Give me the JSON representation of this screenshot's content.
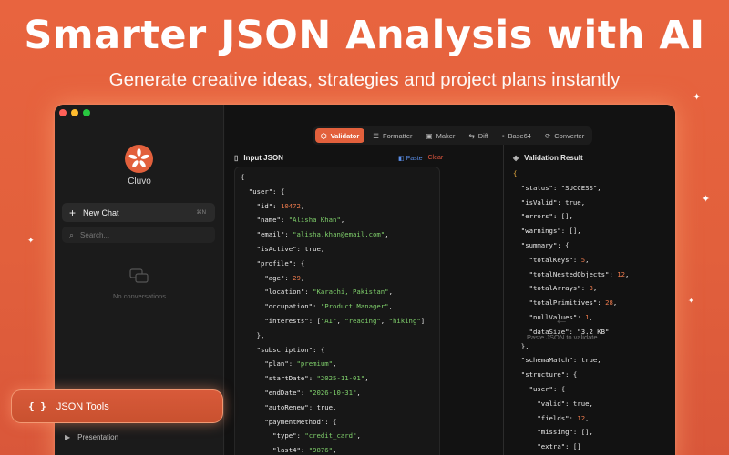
{
  "hero": {
    "title": "Smarter JSON Analysis with AI",
    "subtitle": "Generate creative ideas, strategies and project plans instantly"
  },
  "colors": {
    "accent": "#e2603c",
    "background": "#141414",
    "string": "#7fcf6b",
    "number": "#ec7a4d"
  },
  "sidebar": {
    "brand": "Cluvo",
    "new_chat": "New Chat",
    "new_chat_shortcut": "⌘N",
    "search_placeholder": "Search...",
    "empty_state": "No conversations",
    "presentation": "Presentation",
    "json_tools": "JSON Tools"
  },
  "toolbar": {
    "tabs": [
      {
        "label": "Validator",
        "icon": "validator-icon",
        "active": true
      },
      {
        "label": "Formatter",
        "icon": "formatter-icon",
        "active": false
      },
      {
        "label": "Maker",
        "icon": "maker-icon",
        "active": false
      },
      {
        "label": "Diff",
        "icon": "diff-icon",
        "active": false
      },
      {
        "label": "Base64",
        "icon": "lock-icon",
        "active": false
      },
      {
        "label": "Converter",
        "icon": "converter-icon",
        "active": false
      }
    ]
  },
  "input_pane": {
    "title": "Input JSON",
    "paste_label": "Paste",
    "clear_label": "Clear"
  },
  "result_pane": {
    "title": "Validation Result",
    "paste_hint": "Paste JSON to validate"
  }
}
